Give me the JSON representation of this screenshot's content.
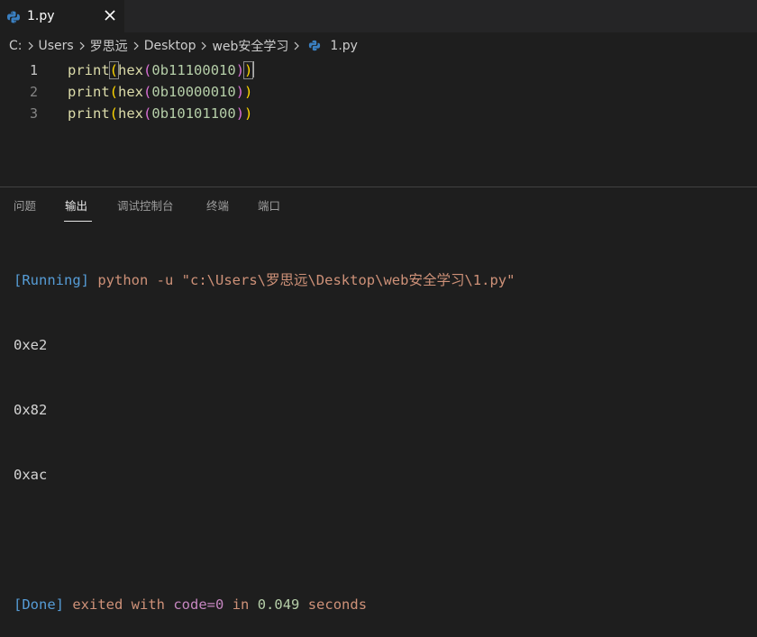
{
  "tab": {
    "filename": "1.py"
  },
  "breadcrumb": {
    "items": [
      "C:",
      "Users",
      "罗思远",
      "Desktop",
      "web安全学习",
      "1.py"
    ]
  },
  "editor": {
    "lines": [
      {
        "number": "1",
        "fn": "print",
        "open1": "(",
        "inner": "hex",
        "open2": "(",
        "prefix": "0b",
        "digits": "11100010",
        "close2": ")",
        "close1": ")"
      },
      {
        "number": "2",
        "fn": "print",
        "open1": "(",
        "inner": "hex",
        "open2": "(",
        "prefix": "0b",
        "digits": "10000010",
        "close2": ")",
        "close1": ")"
      },
      {
        "number": "3",
        "fn": "print",
        "open1": "(",
        "inner": "hex",
        "open2": "(",
        "prefix": "0b",
        "digits": "10101100",
        "close2": ")",
        "close1": ")"
      }
    ]
  },
  "panel": {
    "tabs": [
      "问题",
      "输出",
      "调试控制台",
      "终端",
      "端口"
    ],
    "active_tab": "输出"
  },
  "output": {
    "running_tag": "[Running]",
    "command": "python -u \"c:\\Users\\罗思远\\Desktop\\web安全学习\\1.py\"",
    "results": [
      "0xe2",
      "0x82",
      "0xac"
    ],
    "done_tag": "[Done]",
    "exited_text": "exited with",
    "code_text": "code=0",
    "in_text": "in",
    "duration": "0.049",
    "seconds_text": "seconds"
  },
  "colors": {
    "background": "#1e1e1e",
    "tabbar": "#252526",
    "python_icon": "#3a7fc0",
    "function": "#dcdcaa",
    "paren_level1": "#ffd700",
    "paren_level2": "#da70d6",
    "number": "#b5cea8",
    "string": "#ce9178",
    "tag": "#569cd6"
  },
  "icons": {
    "file_icon": "python-icon",
    "close": "close-icon",
    "separator": "chevron-right-icon"
  }
}
